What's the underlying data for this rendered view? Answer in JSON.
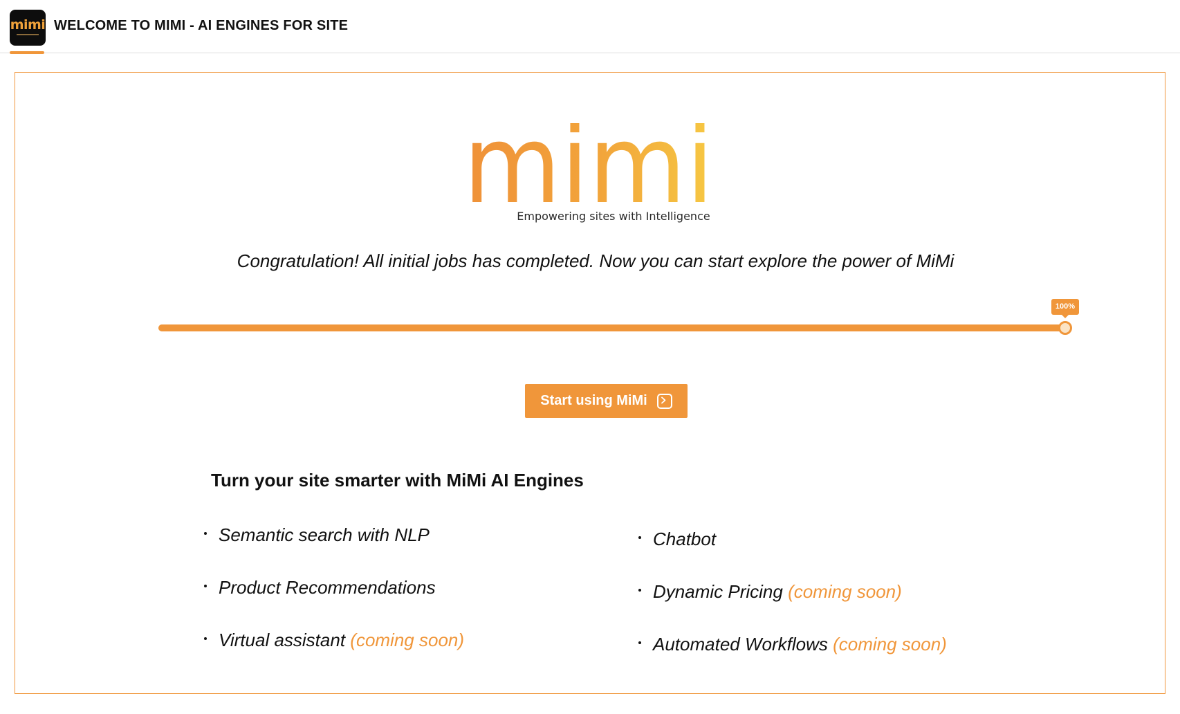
{
  "header": {
    "logo_text": "mimi",
    "title": "WELCOME TO MIMI - AI ENGINES FOR SITE"
  },
  "brand": {
    "wordmark": "mimi",
    "tagline": "Empowering sites with Intelligence"
  },
  "message": "Congratulation! All initial jobs has completed. Now you can start explore the power of MiMi",
  "progress": {
    "value": 1.0,
    "label": "100%"
  },
  "start_button": {
    "label": "Start using MiMi",
    "icon": "arrow-right-square-icon"
  },
  "features": {
    "heading": "Turn your site smarter with MiMi AI Engines",
    "left": [
      {
        "name": "Semantic search with NLP",
        "note": ""
      },
      {
        "name": "Product Recommendations",
        "note": ""
      },
      {
        "name": "Virtual assistant ",
        "note": "(coming soon)"
      }
    ],
    "right": [
      {
        "name": "Chatbot",
        "note": ""
      },
      {
        "name": "Dynamic Pricing ",
        "note": "(coming soon)"
      },
      {
        "name": "Automated Workflows ",
        "note": "(coming soon)"
      }
    ]
  },
  "colors": {
    "accent": "#f0963a",
    "accent_light": "#f5c442",
    "logo_bg": "#0d0d0d"
  }
}
